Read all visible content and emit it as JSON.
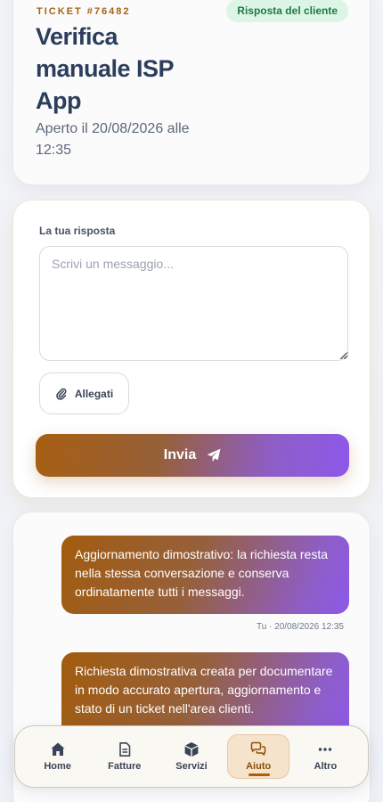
{
  "ticket": {
    "number": "TICKET #76482",
    "status": "Risposta del cliente",
    "title": "Verifica manuale ISP App",
    "opened": "Aperto il 20/08/2026 alle 12:35"
  },
  "reply": {
    "label": "La tua risposta",
    "placeholder": "Scrivi un messaggio...",
    "attach_label": "Allegati",
    "send_label": "Invia"
  },
  "messages": [
    {
      "text": "Aggiornamento dimostrativo: la richiesta resta nella stessa conversazione e conserva ordinatamente tutti i messaggi.",
      "meta": "Tu · 20/08/2026 12:35"
    },
    {
      "text": "Richiesta dimostrativa creata per documentare in modo accurato apertura, aggiornamento e stato di un ticket nell'area clienti."
    }
  ],
  "nav": {
    "items": [
      {
        "label": "Home",
        "icon": "home-icon"
      },
      {
        "label": "Fatture",
        "icon": "document-icon"
      },
      {
        "label": "Servizi",
        "icon": "box-icon"
      },
      {
        "label": "Aiuto",
        "icon": "chat-icon",
        "active": true
      },
      {
        "label": "Altro",
        "icon": "more-icon"
      }
    ]
  },
  "colors": {
    "accent": "#a5620f",
    "gradient_start": "#a85f12",
    "gradient_end": "#8d58ea",
    "status_bg": "#dcf5e6",
    "status_text": "#1e7a44"
  }
}
